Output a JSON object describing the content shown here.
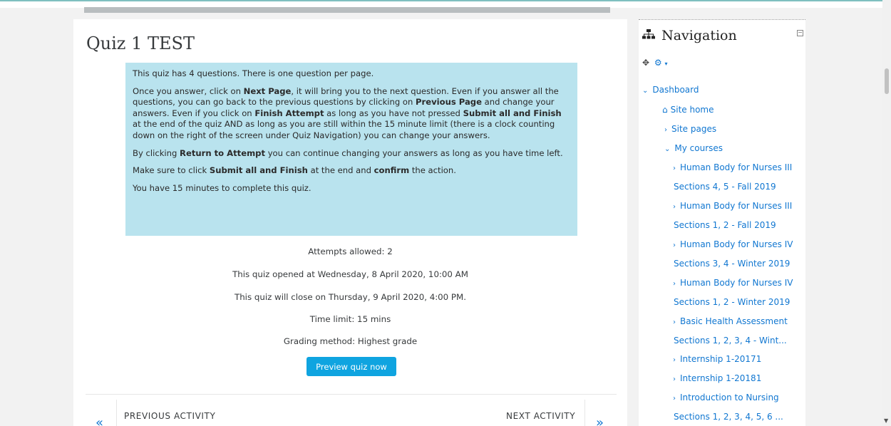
{
  "quiz": {
    "title": "Quiz 1 TEST",
    "info": {
      "p1": "This quiz has 4 questions. There is one question per page.",
      "p2_a": "Once you answer, click on ",
      "p2_b": "Next Page",
      "p2_c": ", it will bring you to the next question. Even if you answer all the questions, you can go back to the previous questions by clicking on ",
      "p2_d": "Previous Page",
      "p2_e": " and change your answers. Even if you click on ",
      "p2_f": "Finish Attempt",
      "p2_g": " as long as you have not pressed ",
      "p2_h": "Submit all and Finish",
      "p2_i": " at the end of the quiz  AND as long as you are still within the 15 minute limit (there is a clock counting down on the right of the screen under Quiz Navigation) you can change your answers.",
      "p3_a": "By clicking ",
      "p3_b": "Return to Attempt",
      "p3_c": " you can continue changing your answers as long as you have time left.",
      "p4_a": "Make sure to click ",
      "p4_b": "Submit all and Finish",
      "p4_c": " at the end and ",
      "p4_d": "confirm",
      "p4_e": " the action.",
      "p5": "You have 15 minutes to complete this quiz."
    },
    "attempts": "Attempts allowed: 2",
    "opened": "This quiz opened at Wednesday, 8 April 2020, 10:00 AM",
    "closes": "This quiz will close on Thursday, 9 April 2020, 4:00 PM.",
    "time_limit": "Time limit: 15 mins",
    "grading": "Grading method: Highest grade",
    "preview_button": "Preview quiz now",
    "prev_label": "PREVIOUS ACTIVITY",
    "next_label": "NEXT ACTIVITY",
    "prev_arrow": "«",
    "next_arrow": "»"
  },
  "navigation": {
    "title": "Navigation",
    "collapse_symbol": "−",
    "move_icon": "✥",
    "gear_icon": "⚙",
    "caret": "▾",
    "items": [
      {
        "label": "Dashboard",
        "chevron": "⌄"
      },
      {
        "label": "Site home",
        "chevron": ""
      },
      {
        "label": "Site pages",
        "chevron": "›"
      },
      {
        "label": "My courses",
        "chevron": "⌄"
      },
      {
        "label": "Human Body for Nurses III",
        "chevron": "›"
      },
      {
        "label": "Sections 4, 5 - Fall 2019",
        "chevron": ""
      },
      {
        "label": "Human Body for Nurses III",
        "chevron": "›"
      },
      {
        "label": "Sections 1, 2 - Fall 2019",
        "chevron": ""
      },
      {
        "label": "Human Body for Nurses IV",
        "chevron": "›"
      },
      {
        "label": "Sections 3, 4 - Winter 2019",
        "chevron": ""
      },
      {
        "label": "Human Body for Nurses IV",
        "chevron": "›"
      },
      {
        "label": "Sections 1, 2 - Winter 2019",
        "chevron": ""
      },
      {
        "label": "Basic Health Assessment",
        "chevron": "›"
      },
      {
        "label": "Sections 1, 2, 3, 4 - Wint...",
        "chevron": ""
      },
      {
        "label": "Internship 1-20171",
        "chevron": "›"
      },
      {
        "label": "Internship 1-20181",
        "chevron": "›"
      },
      {
        "label": "Introduction to Nursing",
        "chevron": "›"
      },
      {
        "label": "Sections 1, 2, 3, 4, 5, 6 ...",
        "chevron": ""
      }
    ]
  },
  "colors": {
    "link": "#1177d1",
    "info_bg": "#b9e3ee",
    "button": "#0fa4e0"
  }
}
